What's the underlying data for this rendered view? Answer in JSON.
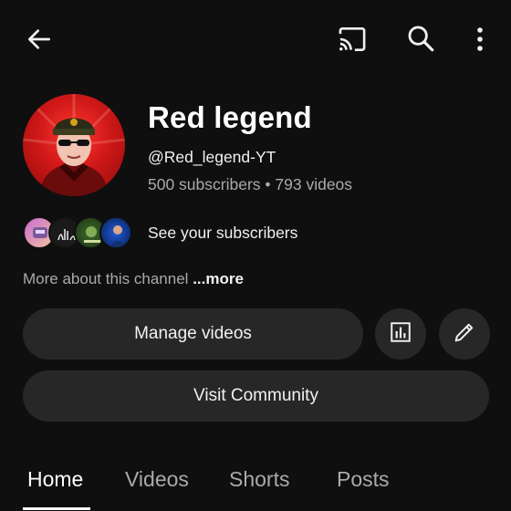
{
  "header": {
    "back_icon": "arrow-left-icon",
    "cast_icon": "cast-icon",
    "search_icon": "search-icon",
    "more_icon": "more-vertical-icon"
  },
  "channel": {
    "name": "Red legend",
    "handle": "@Red_legend-YT",
    "stats": "500 subscribers • 793 videos",
    "subscribers_link": "See your subscribers",
    "about": "More about this channel",
    "about_more": "...more"
  },
  "actions": {
    "manage_videos": "Manage videos",
    "analytics_icon": "analytics-icon",
    "edit_icon": "pencil-icon",
    "visit_community": "Visit Community"
  },
  "tabs": [
    {
      "label": "Home",
      "active": true
    },
    {
      "label": "Videos",
      "active": false
    },
    {
      "label": "Shorts",
      "active": false
    },
    {
      "label": "Posts",
      "active": false
    }
  ],
  "colors": {
    "background": "#0f0f0f",
    "button": "#272727",
    "secondary_text": "#aaaaaa",
    "primary_text": "#f1f1f1"
  }
}
